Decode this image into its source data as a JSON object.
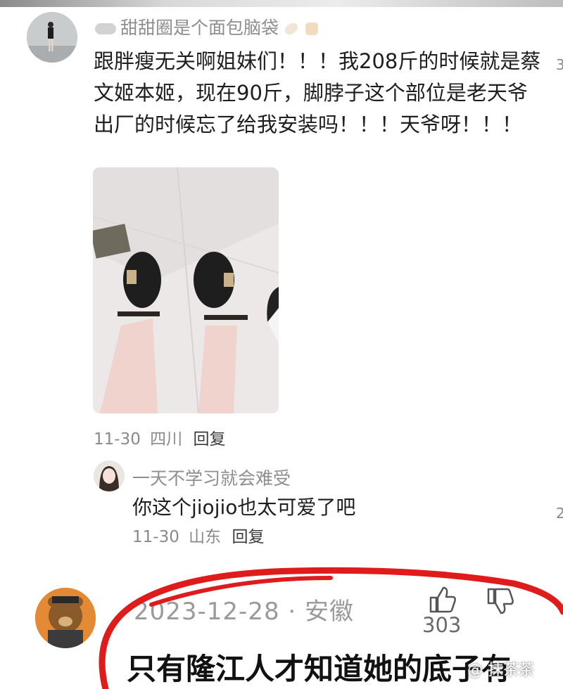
{
  "comment": {
    "username": "甜甜圈是个面包脑袋",
    "text": "跟胖瘦无关啊姐妹们！！！我208斤的时候就是蔡文姬本姬，现在90斤，脚脖子这个部位是老天爷出厂的时候忘了给我安装吗！！！天爷呀！！！",
    "date": "11-30",
    "location": "四川",
    "reply_label": "回复"
  },
  "reply": {
    "username": "一天不学习就会难受",
    "text": "你这个jiojio也太可爱了吧",
    "date": "11-30",
    "location": "山东",
    "reply_label": "回复"
  },
  "right_edge": [
    "3",
    "2"
  ],
  "post": {
    "date": "2023-12-28 · 安徽",
    "like_count": "303",
    "text": "只有隆江人才知道她的底子有"
  },
  "watermark": "@ 抹茶茶",
  "colors": {
    "annotation_red": "#e01b1b",
    "text_primary": "#1e1e1e",
    "text_meta": "#8a8a8a"
  }
}
